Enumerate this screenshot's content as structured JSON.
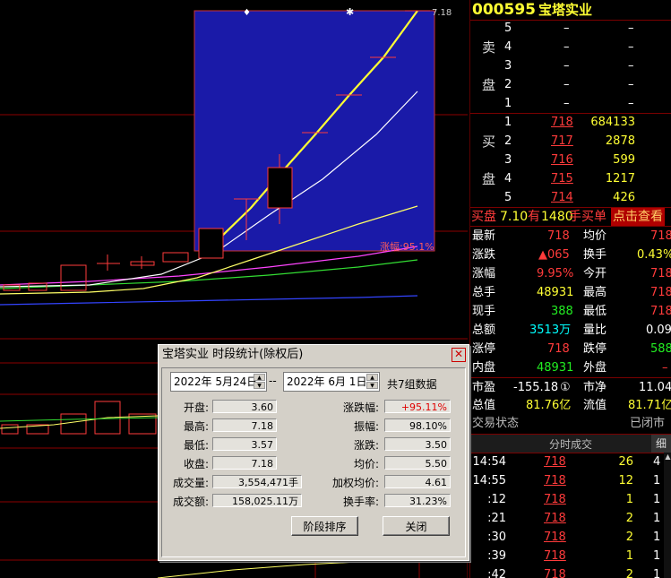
{
  "chart": {
    "price_top_label": "7.18",
    "range_change_label": "涨幅:95.1%",
    "colors": {
      "box": "#1a1aa8",
      "up": "#ff3b3b",
      "grid": "#8b0000",
      "ma1": "#ffffff",
      "ma2": "#ffff66",
      "ma3": "#ff44ff",
      "ma4": "#33dd33",
      "ma5": "#3344ff"
    }
  },
  "stock": {
    "code": "000595",
    "name": "宝塔实业"
  },
  "sell_side_label": [
    "卖",
    "盘"
  ],
  "buy_side_label": [
    "买",
    "盘"
  ],
  "sell_levels": [
    {
      "level": "5",
      "price": "–",
      "vol": "–"
    },
    {
      "level": "4",
      "price": "–",
      "vol": "–"
    },
    {
      "level": "3",
      "price": "–",
      "vol": "–"
    },
    {
      "level": "2",
      "price": "–",
      "vol": "–"
    },
    {
      "level": "1",
      "price": "–",
      "vol": "–"
    }
  ],
  "buy_levels": [
    {
      "level": "1",
      "price": "718",
      "vol": "684133"
    },
    {
      "level": "2",
      "price": "717",
      "vol": "2878"
    },
    {
      "level": "3",
      "price": "716",
      "vol": "599"
    },
    {
      "level": "4",
      "price": "715",
      "vol": "1217"
    },
    {
      "level": "5",
      "price": "714",
      "vol": "426"
    }
  ],
  "order_banner": {
    "prefix": "买盘",
    "price": "7.10",
    "has": "有",
    "qty": "1480",
    "suffix": "手买单",
    "link": "点击查看"
  },
  "quote": {
    "latest_label": "最新",
    "latest": "718",
    "avg_label": "均价",
    "avg": "718",
    "chg_label": "涨跌",
    "chg": "▲065",
    "turnover_label": "换手",
    "turnover": "0.43%",
    "pct_label": "涨幅",
    "pct": "9.95%",
    "open_label": "今开",
    "open": "718",
    "total_label": "总手",
    "total": "48931",
    "high_label": "最高",
    "high": "718",
    "cur_label": "现手",
    "cur": "388",
    "low_label": "最低",
    "low": "718",
    "amount_label": "总额",
    "amount": "3513万",
    "volratio_label": "量比",
    "volratio": "0.09",
    "limitup_label": "涨停",
    "limitup": "718",
    "limitdown_label": "跌停",
    "limitdown": "588",
    "inner_label": "内盘",
    "inner": "48931",
    "outer_label": "外盘",
    "outer": "–",
    "pe_label": "市盈",
    "pe": "-155.18",
    "pe_badge": "①",
    "pb_label": "市净",
    "pb": "11.04",
    "mv_label": "总值",
    "mv": "81.76亿",
    "fmv_label": "流值",
    "fmv": "81.71亿",
    "status_label": "交易状态",
    "status": "已闭市"
  },
  "ticks_header": {
    "title": "分时成交",
    "tab": "细"
  },
  "ticks": [
    {
      "time": "14:54",
      "price": "718",
      "vol": "26",
      "n": "4"
    },
    {
      "time": "14:55",
      "price": "718",
      "vol": "12",
      "n": "1"
    },
    {
      "time": ":12",
      "price": "718",
      "vol": "1",
      "n": "1"
    },
    {
      "time": ":21",
      "price": "718",
      "vol": "2",
      "n": "1"
    },
    {
      "time": ":30",
      "price": "718",
      "vol": "2",
      "n": "1"
    },
    {
      "time": ":39",
      "price": "718",
      "vol": "1",
      "n": "1"
    },
    {
      "time": ":42",
      "price": "718",
      "vol": "2",
      "n": "1"
    }
  ],
  "dialog": {
    "title": "宝塔实业 时段统计(除权后)",
    "start_date": "2022年 5月24日",
    "separator": "--",
    "end_date": "2022年 6月 1日",
    "count_text": "共7组数据",
    "left": [
      {
        "label": "开盘:",
        "value": "3.60"
      },
      {
        "label": "最高:",
        "value": "7.18"
      },
      {
        "label": "最低:",
        "value": "3.57"
      },
      {
        "label": "收盘:",
        "value": "7.18"
      },
      {
        "label": "成交量:",
        "value": "3,554,471手"
      },
      {
        "label": "成交额:",
        "value": "158,025.11万"
      }
    ],
    "right": [
      {
        "label": "涨跌幅:",
        "value": "+95.11%"
      },
      {
        "label": "振幅:",
        "value": "98.10%"
      },
      {
        "label": "涨跌:",
        "value": "3.50"
      },
      {
        "label": "均价:",
        "value": "5.50"
      },
      {
        "label": "加权均价:",
        "value": "4.61"
      },
      {
        "label": "换手率:",
        "value": "31.23%"
      }
    ],
    "rank_button": "阶段排序",
    "close_button": "关闭"
  }
}
